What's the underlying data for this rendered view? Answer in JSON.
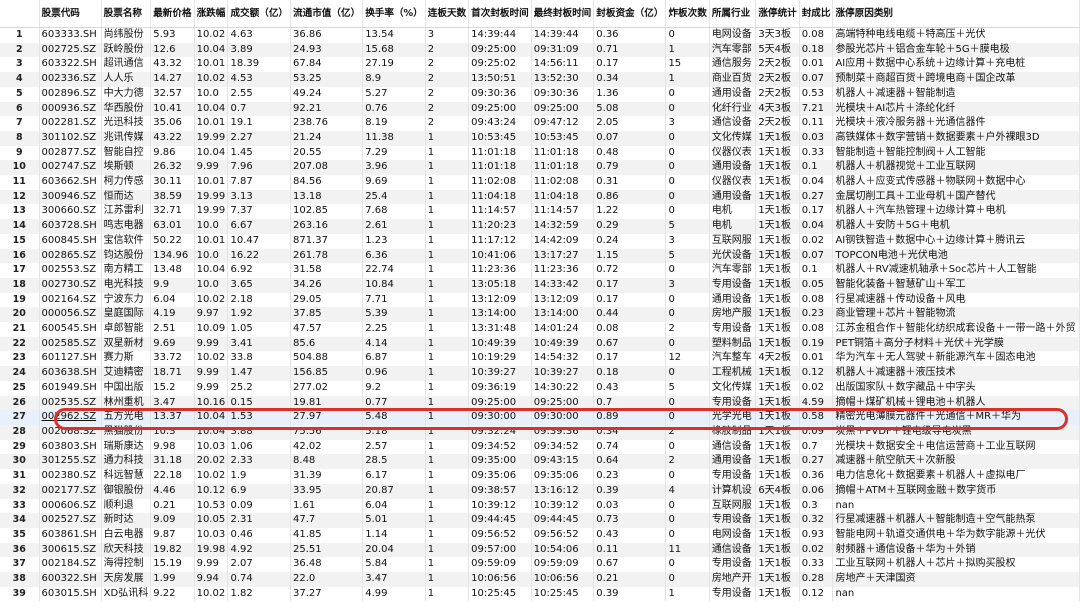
{
  "columns": [
    "",
    "股票代码",
    "股票名称",
    "最新价格",
    "涨跌幅",
    "成交额（亿）",
    "流通市值（亿）",
    "换手率（%）",
    "连板天数",
    "首次封板时间",
    "最终封板时间",
    "封板资金（亿）",
    "炸板次数",
    "所属行业",
    "涨停统计",
    "封成比",
    "涨停原因类别"
  ],
  "rows": [
    [
      "1",
      "603333.SH",
      "尚纬股份",
      "5.93",
      "10.02",
      "4.63",
      "36.86",
      "13.54",
      "3",
      "14:39:44",
      "14:39:44",
      "0.36",
      "0",
      "电网设备",
      "3天3板",
      "0.08",
      "高端特种电线电缆＋特高压＋光伏"
    ],
    [
      "2",
      "002725.SZ",
      "跃岭股份",
      "12.6",
      "10.04",
      "3.89",
      "24.93",
      "15.68",
      "2",
      "09:25:00",
      "09:31:09",
      "0.71",
      "1",
      "汽车零部",
      "5天4板",
      "0.18",
      "参股光芯片＋铝合金车轮＋5G＋膜电极"
    ],
    [
      "3",
      "603322.SH",
      "超讯通信",
      "43.32",
      "10.01",
      "18.39",
      "67.84",
      "27.19",
      "2",
      "09:25:02",
      "14:56:11",
      "0.17",
      "15",
      "通信服务",
      "2天2板",
      "0.01",
      "AI应用＋数据中心系统＋边缘计算＋充电桩"
    ],
    [
      "4",
      "002336.SZ",
      "人人乐",
      "14.27",
      "10.02",
      "4.53",
      "53.25",
      "8.9",
      "2",
      "13:50:51",
      "13:52:30",
      "0.34",
      "1",
      "商业百货",
      "2天2板",
      "0.07",
      "预制菜＋商超百货＋跨境电商＋国企改革"
    ],
    [
      "5",
      "002896.SZ",
      "中大力德",
      "32.57",
      "10.0",
      "2.55",
      "49.24",
      "5.27",
      "2",
      "09:30:36",
      "09:30:36",
      "1.36",
      "0",
      "通用设备",
      "2天2板",
      "0.53",
      "机器人＋减速器＋智能制造"
    ],
    [
      "6",
      "000936.SZ",
      "华西股份",
      "10.41",
      "10.04",
      "0.7",
      "92.21",
      "0.76",
      "2",
      "09:25:00",
      "09:25:00",
      "5.08",
      "0",
      "化纤行业",
      "4天3板",
      "7.21",
      "光模块＋AI芯片＋涤纶化纤"
    ],
    [
      "7",
      "002281.SZ",
      "光迅科技",
      "35.06",
      "10.01",
      "19.1",
      "238.76",
      "8.19",
      "2",
      "09:43:24",
      "09:47:12",
      "2.05",
      "3",
      "通信设备",
      "2天2板",
      "0.11",
      "光模块＋液冷服务器＋光通信器件"
    ],
    [
      "8",
      "301102.SZ",
      "兆讯传媒",
      "43.22",
      "19.99",
      "2.27",
      "21.24",
      "11.38",
      "1",
      "10:53:45",
      "10:53:45",
      "0.07",
      "0",
      "文化传媒",
      "1天1板",
      "0.03",
      "高铁媒体＋数字营销＋数据要素＋户外裸眼3D"
    ],
    [
      "9",
      "002877.SZ",
      "智能自控",
      "9.86",
      "10.04",
      "1.45",
      "20.55",
      "7.29",
      "1",
      "11:01:18",
      "11:01:18",
      "0.48",
      "0",
      "仪器仪表",
      "1天1板",
      "0.33",
      "智能制造＋智能控制阀＋人工智能"
    ],
    [
      "10",
      "002747.SZ",
      "埃斯顿",
      "26.32",
      "9.99",
      "7.96",
      "207.08",
      "3.96",
      "1",
      "11:01:18",
      "11:01:18",
      "0.79",
      "0",
      "通用设备",
      "1天1板",
      "0.1",
      "机器人＋机器视觉＋工业互联网"
    ],
    [
      "11",
      "603662.SH",
      "柯力传感",
      "30.11",
      "10.01",
      "7.87",
      "84.56",
      "9.69",
      "1",
      "11:02:08",
      "11:02:08",
      "0.31",
      "0",
      "仪器仪表",
      "1天1板",
      "0.04",
      "机器人＋应变式传感器＋物联网＋数据中心"
    ],
    [
      "12",
      "300946.SZ",
      "恒而达",
      "38.59",
      "19.99",
      "3.13",
      "13.18",
      "25.4",
      "1",
      "11:04:18",
      "11:04:18",
      "0.86",
      "0",
      "通用设备",
      "1天1板",
      "0.27",
      "金属切削工具＋工业母机＋国产替代"
    ],
    [
      "13",
      "300660.SZ",
      "江苏雷利",
      "32.71",
      "19.99",
      "7.37",
      "102.85",
      "7.68",
      "1",
      "11:14:57",
      "11:14:57",
      "1.22",
      "0",
      "电机",
      "1天1板",
      "0.17",
      "机器人＋汽车热管理＋边缘计算＋电机"
    ],
    [
      "14",
      "603728.SH",
      "鸣志电器",
      "63.01",
      "10.0",
      "6.67",
      "263.16",
      "2.61",
      "1",
      "11:20:23",
      "14:32:59",
      "0.29",
      "5",
      "电机",
      "1天1板",
      "0.04",
      "机器人＋安防＋5G＋电机"
    ],
    [
      "15",
      "600845.SH",
      "宝信软件",
      "50.22",
      "10.01",
      "10.47",
      "871.37",
      "1.23",
      "1",
      "11:17:12",
      "14:42:09",
      "0.24",
      "3",
      "互联网服",
      "1天1板",
      "0.02",
      "AI钢铁智造＋数据中心＋边缘计算＋腾讯云"
    ],
    [
      "16",
      "002865.SZ",
      "钧达股份",
      "134.96",
      "10.0",
      "16.22",
      "261.78",
      "6.36",
      "1",
      "10:41:06",
      "13:17:27",
      "1.15",
      "5",
      "光伏设备",
      "1天1板",
      "0.07",
      "TOPCON电池＋光伏电池"
    ],
    [
      "17",
      "002553.SZ",
      "南方精工",
      "13.48",
      "10.04",
      "6.92",
      "31.58",
      "22.74",
      "1",
      "11:23:36",
      "11:23:36",
      "0.72",
      "0",
      "汽车零部",
      "1天1板",
      "0.1",
      "机器人＋RV减速机轴承＋Soc芯片＋人工智能"
    ],
    [
      "18",
      "002730.SZ",
      "电光科技",
      "9.9",
      "10.0",
      "3.65",
      "34.26",
      "10.84",
      "1",
      "13:05:18",
      "14:33:42",
      "0.17",
      "3",
      "专用设备",
      "1天1板",
      "0.05",
      "智能化装备＋智慧矿山＋军工"
    ],
    [
      "19",
      "002164.SZ",
      "宁波东力",
      "6.04",
      "10.02",
      "2.18",
      "29.05",
      "7.71",
      "1",
      "13:12:09",
      "13:12:09",
      "0.17",
      "0",
      "通用设备",
      "1天1板",
      "0.08",
      "行星减速器＋传动设备＋风电"
    ],
    [
      "20",
      "000056.SZ",
      "皇庭国际",
      "4.19",
      "9.97",
      "1.92",
      "37.85",
      "5.39",
      "1",
      "13:14:00",
      "13:14:00",
      "0.44",
      "0",
      "房地产服",
      "1天1板",
      "0.23",
      "商业管理＋芯片＋智能物流"
    ],
    [
      "21",
      "600545.SH",
      "卓郎智能",
      "2.51",
      "10.09",
      "1.05",
      "47.57",
      "2.25",
      "1",
      "13:31:48",
      "14:01:24",
      "0.08",
      "2",
      "专用设备",
      "1天1板",
      "0.08",
      "江苏金租合作＋智能化纺织成套设备＋一带一路＋外贸"
    ],
    [
      "22",
      "002585.SZ",
      "双星新材",
      "9.69",
      "9.99",
      "3.41",
      "85.6",
      "4.14",
      "1",
      "10:49:39",
      "10:49:39",
      "0.67",
      "0",
      "塑料制品",
      "1天1板",
      "0.19",
      "PET铜箔＋高分子材料＋光伏＋光学膜"
    ],
    [
      "23",
      "601127.SH",
      "赛力斯",
      "33.72",
      "10.02",
      "33.8",
      "504.88",
      "6.87",
      "1",
      "10:19:29",
      "14:54:32",
      "0.17",
      "12",
      "汽车整车",
      "4天2板",
      "0.01",
      "华为汽车＋无人驾驶＋新能源汽车＋固态电池"
    ],
    [
      "24",
      "603638.SH",
      "艾迪精密",
      "18.71",
      "9.99",
      "1.47",
      "156.85",
      "0.96",
      "1",
      "10:39:27",
      "10:39:27",
      "0.18",
      "0",
      "工程机械",
      "1天1板",
      "0.12",
      "机器人＋减速器＋液压技术"
    ],
    [
      "25",
      "601949.SH",
      "中国出版",
      "15.2",
      "9.99",
      "25.2",
      "277.02",
      "9.2",
      "1",
      "09:36:19",
      "14:30:22",
      "0.43",
      "5",
      "文化传媒",
      "1天1板",
      "0.02",
      "出版国家队＋数字藏品＋中字头"
    ],
    [
      "26",
      "002535.SZ",
      "林州重机",
      "3.47",
      "10.16",
      "0.15",
      "19.81",
      "0.77",
      "1",
      "09:25:00",
      "09:25:00",
      "0.7",
      "0",
      "专用设备",
      "1天1板",
      "4.59",
      "摘帽＋煤矿机械＋锂电池＋机器人"
    ],
    [
      "27",
      "002962.SZ",
      "五方光电",
      "13.37",
      "10.04",
      "1.53",
      "27.97",
      "5.48",
      "1",
      "09:30:00",
      "09:30:00",
      "0.89",
      "0",
      "光学光电",
      "1天1板",
      "0.58",
      "精密光电薄膜元器件＋光通信＋MR＋华为"
    ],
    [
      "28",
      "002068.SZ",
      "黑猫股份",
      "10.3",
      "10.04",
      "3.88",
      "75.56",
      "5.18",
      "1",
      "09:32:24",
      "09:39:36",
      "0.34",
      "2",
      "橡胶制品",
      "1天1板",
      "0.09",
      "炭黑＋PVDF＋锂电级导电炭黑"
    ],
    [
      "29",
      "603803.SH",
      "瑞斯康达",
      "9.98",
      "10.03",
      "1.06",
      "42.02",
      "2.57",
      "1",
      "09:34:52",
      "09:34:52",
      "0.74",
      "0",
      "通信设备",
      "1天1板",
      "0.7",
      "光模块＋数据安全＋电信运营商＋工业互联网"
    ],
    [
      "30",
      "301255.SZ",
      "通力科技",
      "31.18",
      "20.02",
      "2.33",
      "8.48",
      "28.5",
      "1",
      "09:35:00",
      "09:43:15",
      "0.64",
      "2",
      "通用设备",
      "1天1板",
      "0.27",
      "减速器＋航空航天＋次新股"
    ],
    [
      "31",
      "002380.SZ",
      "科远智慧",
      "22.18",
      "10.02",
      "1.9",
      "31.39",
      "6.17",
      "1",
      "09:35:06",
      "09:35:06",
      "0.23",
      "0",
      "专用设备",
      "1天1板",
      "0.36",
      "电力信息化＋数据要素＋机器人＋虚拟电厂"
    ],
    [
      "32",
      "002177.SZ",
      "御银股份",
      "4.46",
      "10.12",
      "6.9",
      "33.95",
      "20.87",
      "1",
      "09:38:57",
      "13:16:12",
      "0.39",
      "4",
      "计算机设",
      "6天4板",
      "0.06",
      "摘帽＋ATM＋互联网金融＋数字货币"
    ],
    [
      "33",
      "000606.SZ",
      "顺利退",
      "0.21",
      "10.53",
      "0.09",
      "1.61",
      "6.04",
      "1",
      "10:39:12",
      "10:39:12",
      "0.03",
      "0",
      "互联网服",
      "1天1板",
      "0.3",
      "nan"
    ],
    [
      "34",
      "002527.SZ",
      "新时达",
      "9.09",
      "10.05",
      "2.31",
      "47.7",
      "5.01",
      "1",
      "09:44:45",
      "09:44:45",
      "0.73",
      "0",
      "专用设备",
      "1天1板",
      "0.32",
      "行星减速器＋机器人＋智能制造＋空气能热泵"
    ],
    [
      "35",
      "603861.SH",
      "白云电器",
      "9.87",
      "10.03",
      "0.46",
      "41.85",
      "1.14",
      "1",
      "09:56:52",
      "09:56:52",
      "0.43",
      "0",
      "电网设备",
      "1天1板",
      "0.93",
      "智能电网＋轨道交通供电＋华为数字能源＋光伏"
    ],
    [
      "36",
      "300615.SZ",
      "欣天科技",
      "19.82",
      "19.98",
      "4.92",
      "25.51",
      "20.04",
      "1",
      "09:57:00",
      "10:54:06",
      "0.11",
      "11",
      "通信设备",
      "1天1板",
      "0.02",
      "射频器＋通信设备＋华为＋外销"
    ],
    [
      "37",
      "002184.SZ",
      "海得控制",
      "15.19",
      "9.99",
      "2.07",
      "36.48",
      "5.84",
      "1",
      "09:59:09",
      "09:59:09",
      "0.67",
      "0",
      "专用设备",
      "1天1板",
      "0.33",
      "工业互联网＋机器人＋芯片＋拟购买股权"
    ],
    [
      "38",
      "600322.SH",
      "天房发展",
      "1.99",
      "9.94",
      "0.74",
      "22.0",
      "3.47",
      "1",
      "10:06:56",
      "10:06:56",
      "0.21",
      "0",
      "房地产开",
      "1天1板",
      "0.28",
      "房地产＋天津国资"
    ],
    [
      "39",
      "603015.SH",
      "XD弘讯科",
      "9.22",
      "10.02",
      "1.82",
      "37.27",
      "4.99",
      "1",
      "10:25:45",
      "10:25:45",
      "0.39",
      "1",
      "专用设备",
      "1天1板",
      "0.12",
      "nan"
    ]
  ]
}
